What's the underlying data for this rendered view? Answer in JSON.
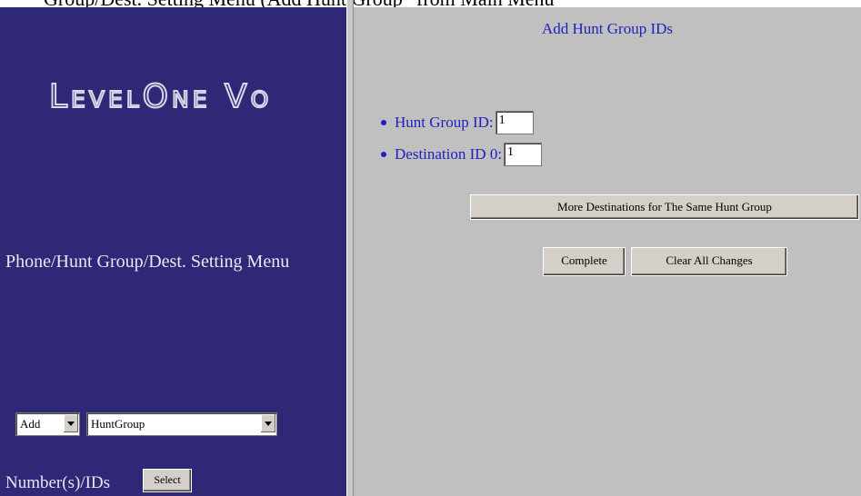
{
  "caption": "Group/Dest. Setting Menu (Add Hunt Group” from Main Menu",
  "left": {
    "logo": "LevelOne Vo",
    "menu_title": "Phone/Hunt Group/Dest. Setting Menu",
    "action_select": "Add",
    "type_select": "HuntGroup",
    "numbers_label": "Number(s)/IDs",
    "select_button": "Select"
  },
  "right": {
    "title": "Add Hunt Group IDs",
    "hunt_group_label": "Hunt Group ID:",
    "hunt_group_value": "1",
    "destination_label": "Destination ID 0:",
    "destination_value": "1",
    "more_button": "More Destinations for The Same Hunt Group",
    "complete_button": "Complete",
    "clear_button": "Clear All Changes"
  },
  "colors": {
    "left_bg": "#2e2877",
    "right_bg": "#c0c0c0",
    "link_blue": "#1f1fbf"
  }
}
